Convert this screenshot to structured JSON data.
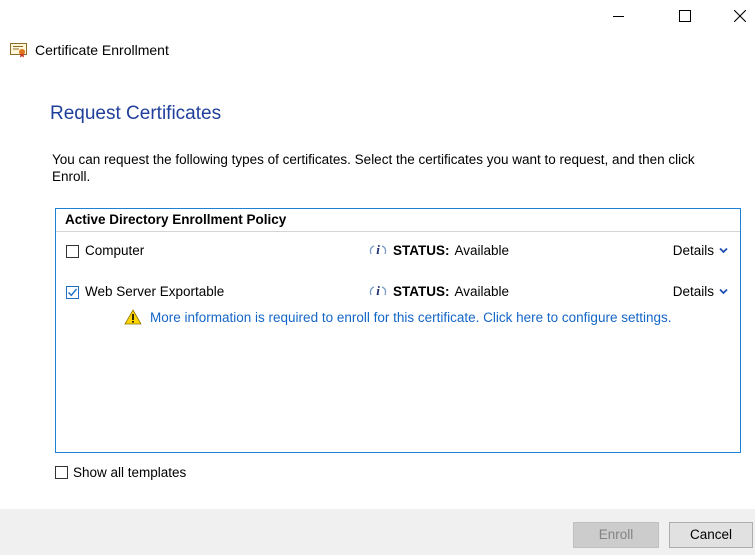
{
  "window": {
    "title": "Certificate Enrollment",
    "controls": {
      "minimize_icon": "minimize-icon",
      "maximize_icon": "maximize-icon",
      "close_icon": "close-icon"
    }
  },
  "page": {
    "title": "Request Certificates",
    "instructions": "You can request the following types of certificates. Select the certificates you want to request, and then click Enroll."
  },
  "policy": {
    "header": "Active Directory Enrollment Policy",
    "certificates": [
      {
        "name": "Computer",
        "checked": false,
        "status_label": "STATUS:",
        "status_value": "Available",
        "details_label": "Details"
      },
      {
        "name": "Web Server Exportable",
        "checked": true,
        "status_label": "STATUS:",
        "status_value": "Available",
        "details_label": "Details",
        "warning": "More information is required to enroll for this certificate. Click here to configure settings."
      }
    ]
  },
  "options": {
    "show_all_templates": "Show all templates",
    "show_all_checked": false
  },
  "buttons": {
    "enroll": "Enroll",
    "enroll_enabled": false,
    "cancel": "Cancel"
  },
  "colors": {
    "accent": "#1f7fd4",
    "title_blue": "#1f3f9b",
    "link_blue": "#1466c8",
    "warning_yellow": "#ffd500"
  }
}
